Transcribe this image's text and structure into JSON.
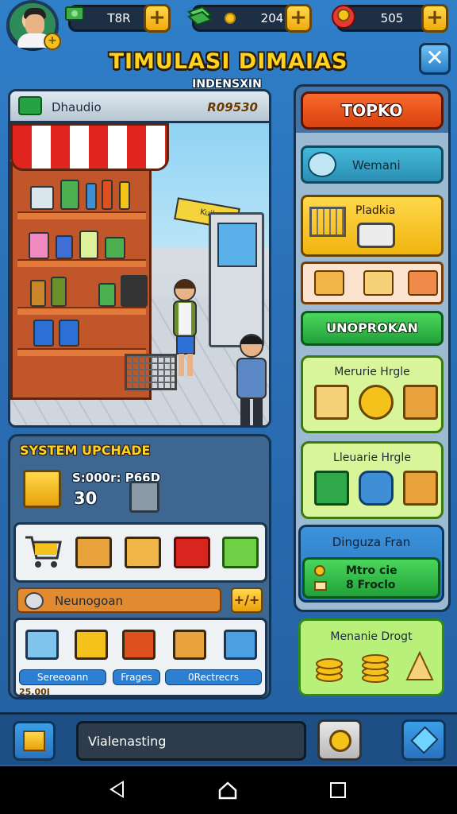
{
  "top_bar": {
    "cash_value": "T8R",
    "coins_value": "204",
    "gems_value": "505",
    "plus_label": "+"
  },
  "header": {
    "title": "TIMULASI DIMAIAS",
    "subtitle": "INDENSXIN",
    "close_label": "✕"
  },
  "scene": {
    "store_name": "Dhaudio",
    "money": "R09530",
    "sign_text": "Kuil"
  },
  "upgrade": {
    "title": "SYSTEM UPCHADE",
    "price": "S:000r: P66D",
    "level": "30",
    "bar_label": "Neunogoan",
    "bar_button": "+/+",
    "pills": [
      "Sereeoann",
      "Frages",
      "0Rectrecrs"
    ],
    "pill_sub": "25.00I"
  },
  "store": {
    "tab_label": "TOPKO",
    "wemari_label": "Wemani",
    "pk_label": "Pladkia",
    "green_tab_label": "UNOPROKAN",
    "card1_label": "Merurie Hrgle",
    "card2_label": "Lleuarie Hrgle",
    "dg_label": "Dinguza Fran",
    "dg_line1": "Mtro cie",
    "dg_line2": "8 Froclo",
    "md_label": "Menanie Drogt"
  },
  "bottom": {
    "field_label": "Vialenasting"
  },
  "colors": {
    "accent_yellow": "#ffd21f",
    "store_orange": "#f96a2c",
    "green": "#21a13a",
    "background_blue": "#2f7fc9"
  }
}
